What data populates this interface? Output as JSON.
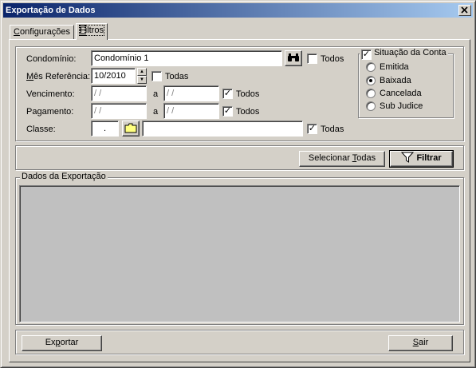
{
  "window": {
    "title": "Exportação de Dados"
  },
  "tabs": [
    {
      "label_pre": "",
      "label_u": "C",
      "label_post": "onfigurações"
    },
    {
      "label_pre": "",
      "label_u": "F",
      "label_post": "iltros"
    }
  ],
  "filters": {
    "condominio": {
      "label": "Condomínio:",
      "value": "Condomínio 1",
      "all_label": "Todos",
      "all_checked": false
    },
    "mes_referencia": {
      "label_u": "M",
      "label_rest": "ês Referência:",
      "value": "10/2010",
      "all_label": "Todas",
      "all_checked": false
    },
    "vencimento": {
      "label": "Vencimento:",
      "from": " / /",
      "sep": "a",
      "to": " / /",
      "all_label": "Todos",
      "all_checked": true
    },
    "pagamento": {
      "label": "Pagamento:",
      "from": " / /",
      "sep": "a",
      "to": " / /",
      "all_label": "Todos",
      "all_checked": true
    },
    "classe": {
      "label": "Classe:",
      "code": ".",
      "description": "",
      "all_label": "Todas",
      "all_checked": true
    },
    "situacao": {
      "title": "Situação da Conta",
      "checked": true,
      "options": [
        {
          "label": "Emitida",
          "selected": false
        },
        {
          "label": "Baixada",
          "selected": true
        },
        {
          "label": "Cancelada",
          "selected": false
        },
        {
          "label": "Sub Judice",
          "selected": false
        }
      ]
    }
  },
  "actions": {
    "select_all_pre": "Selecionar ",
    "select_all_u": "T",
    "select_all_post": "odas",
    "filter_label": "Filtrar"
  },
  "export_data": {
    "title": "Dados da Exportação"
  },
  "footer": {
    "export_pre": "Ex",
    "export_u": "p",
    "export_post": "ortar",
    "exit_u": "S",
    "exit_post": "air"
  },
  "icons": {
    "search": "binoculars-icon",
    "folder": "folder-icon",
    "filter": "funnel-icon",
    "close": "close-icon"
  }
}
